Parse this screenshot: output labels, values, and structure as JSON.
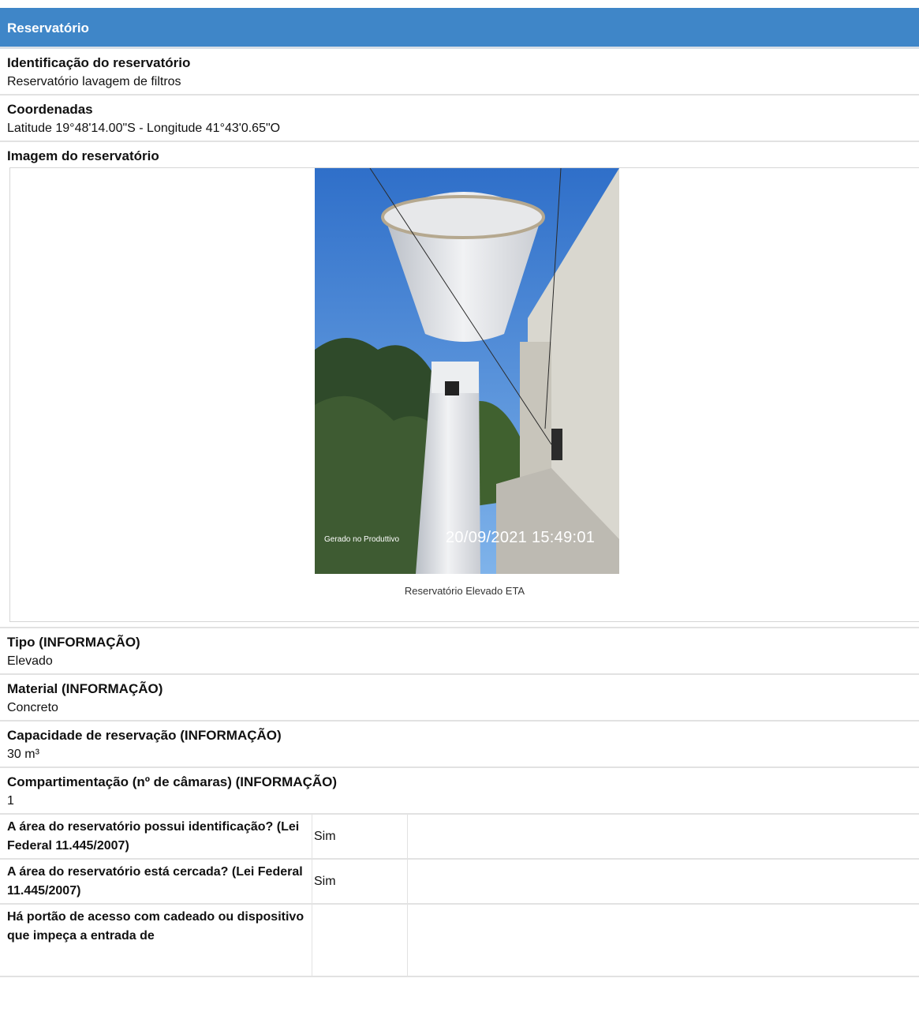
{
  "header": {
    "title": "Reservatório"
  },
  "fields": {
    "identificacao": {
      "label": "Identificação do reservatório",
      "value": "Reservatório lavagem de filtros"
    },
    "coordenadas": {
      "label": "Coordenadas",
      "value": "Latitude 19°48'14.00\"S - Longitude 41°43'0.65\"O"
    },
    "imagem": {
      "label": "Imagem do reservatório",
      "watermark": "Gerado no Produttivo",
      "timestamp": "20/09/2021 15:49:01",
      "caption": "Reservatório Elevado ETA"
    },
    "tipo": {
      "label": "Tipo (INFORMAÇÃO)",
      "value": "Elevado"
    },
    "material": {
      "label": "Material (INFORMAÇÃO)",
      "value": "Concreto"
    },
    "capacidade": {
      "label": "Capacidade de reservação (INFORMAÇÃO)",
      "value": "30 m³"
    },
    "compartimentacao": {
      "label": "Compartimentação (nº de câmaras) (INFORMAÇÃO)",
      "value": "1"
    }
  },
  "questions": [
    {
      "question": "A área do reservatório possui identificação? (Lei Federal 11.445/2007)",
      "answer": "Sim"
    },
    {
      "question": "A área do reservatório está cercada? (Lei Federal 11.445/2007)",
      "answer": "Sim"
    },
    {
      "question": "Há portão de acesso com cadeado ou dispositivo que impeça a entrada de",
      "answer": ""
    }
  ],
  "colors": {
    "header_bg": "#3f86c8",
    "sky": "#3d7fd8",
    "divider": "#e2e2e2"
  }
}
